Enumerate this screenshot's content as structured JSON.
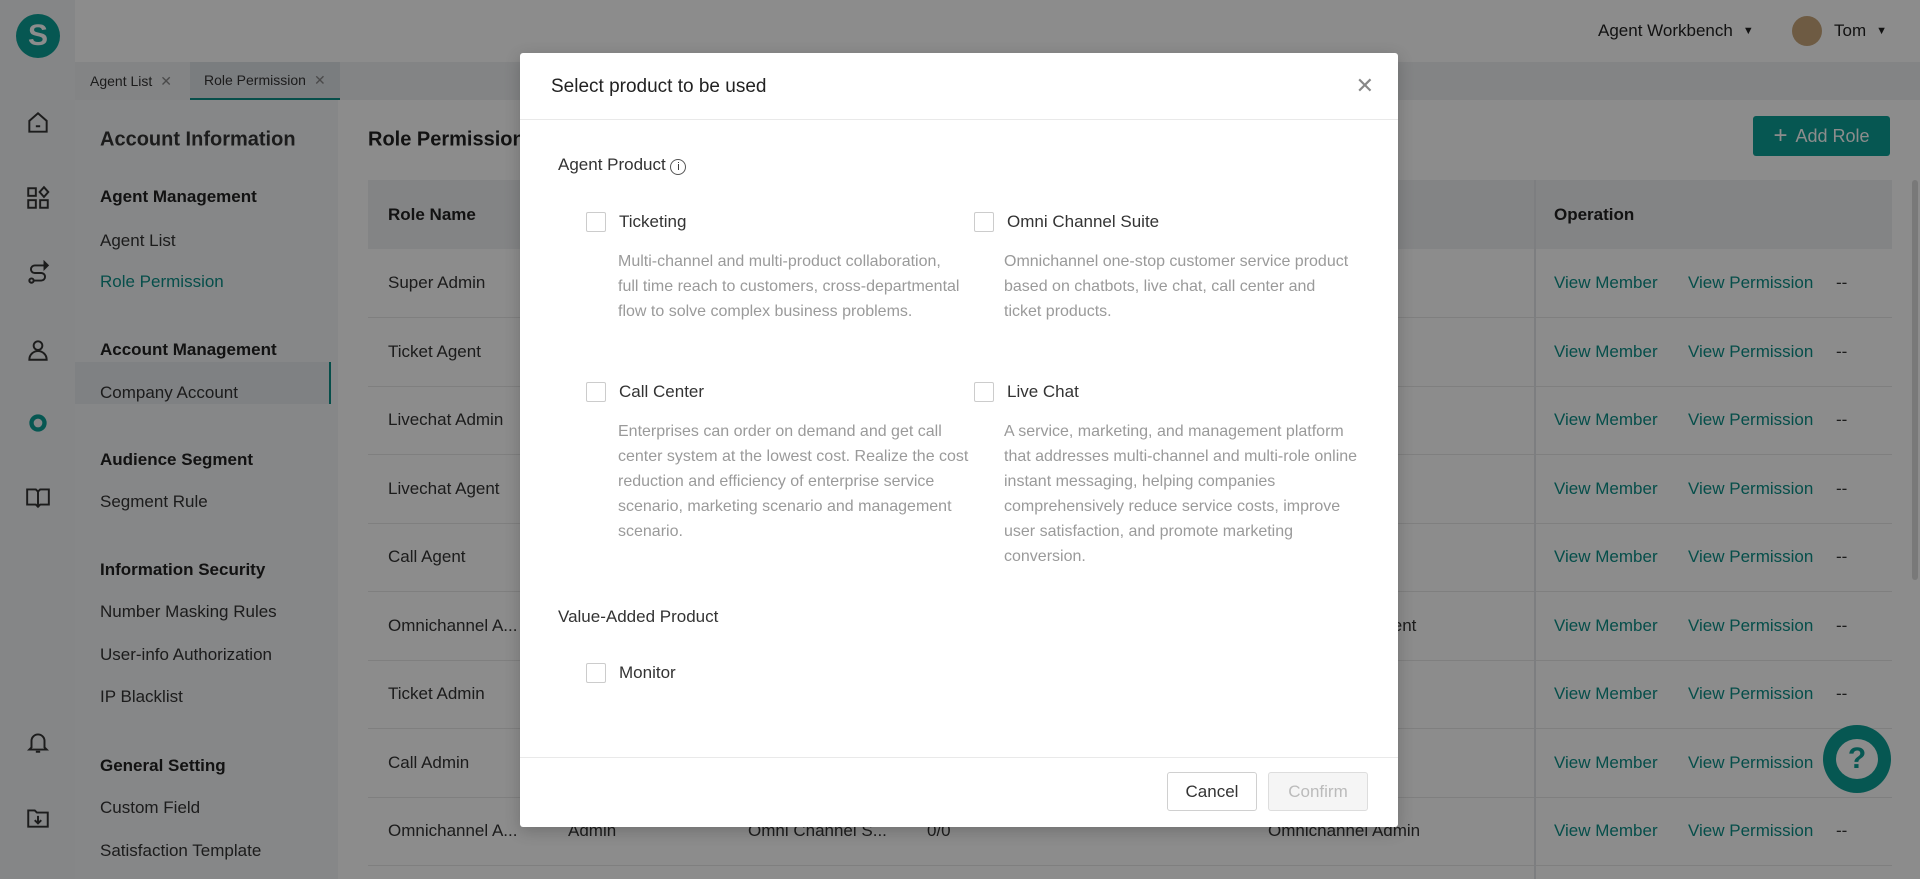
{
  "brand": {
    "logo_letter": "S",
    "accent": "#0b9e95"
  },
  "topbar": {
    "workbench": "Agent Workbench",
    "user": "Tom"
  },
  "tabs": [
    {
      "label": "Agent List"
    },
    {
      "label": "Role Permission"
    }
  ],
  "submenu": {
    "title": "Account Information",
    "groups": [
      {
        "heading": "Agent Management",
        "items": [
          "Agent List",
          "Role Permission"
        ]
      },
      {
        "heading": "Account Management",
        "items": [
          "Company Account"
        ]
      },
      {
        "heading": "Audience Segment",
        "items": [
          "Segment Rule"
        ]
      },
      {
        "heading": "Information Security",
        "items": [
          "Number Masking Rules",
          "User-info Authorization",
          "IP Blacklist"
        ]
      },
      {
        "heading": "General Setting",
        "items": [
          "Custom Field",
          "Satisfaction Template"
        ]
      }
    ],
    "active": "Role Permission"
  },
  "main": {
    "title": "Role Permission",
    "add_role": "Add Role",
    "columns": {
      "role_name": "Role Name",
      "operation": "Operation"
    },
    "rows": [
      {
        "name": "Super Admin"
      },
      {
        "name": "Ticket Agent"
      },
      {
        "name": "Livechat Admin"
      },
      {
        "name": "Livechat Agent"
      },
      {
        "name": "Call Agent"
      },
      {
        "name": "Omnichannel A...",
        "col5": "Omnichannel Agent"
      },
      {
        "name": "Ticket Admin"
      },
      {
        "name": "Call Admin"
      },
      {
        "name": "Omnichannel A...",
        "col2": "Admin",
        "col3": "Omni Channel S...",
        "col4": "0/0",
        "col5": "Omnichannel Admin"
      }
    ],
    "ops": {
      "view_member": "View Member",
      "view_permission": "View Permission",
      "more": "--"
    }
  },
  "modal": {
    "title": "Select product to be used",
    "agent_product": "Agent Product",
    "products": [
      {
        "label": "Ticketing",
        "checked": false,
        "desc": "Multi-channel and multi-product collaboration, full time reach to customers, cross-departmental flow to solve complex business problems."
      },
      {
        "label": "Omni Channel Suite",
        "checked": false,
        "desc": "Omnichannel one-stop customer service product based on chatbots, live chat, call center and ticket products."
      },
      {
        "label": "Call Center",
        "checked": false,
        "desc": "Enterprises can order on demand and get call center system at the lowest cost. Realize the cost reduction and efficiency of enterprise service scenario, marketing scenario and management scenario."
      },
      {
        "label": "Live Chat",
        "checked": false,
        "desc": "A service, marketing, and management platform that addresses multi-channel and multi-role online instant messaging, helping companies comprehensively reduce service costs, improve user satisfaction, and promote marketing conversion."
      }
    ],
    "value_added": "Value-Added Product",
    "value_products": [
      {
        "label": "Monitor",
        "checked": false
      }
    ],
    "cancel": "Cancel",
    "confirm": "Confirm"
  }
}
